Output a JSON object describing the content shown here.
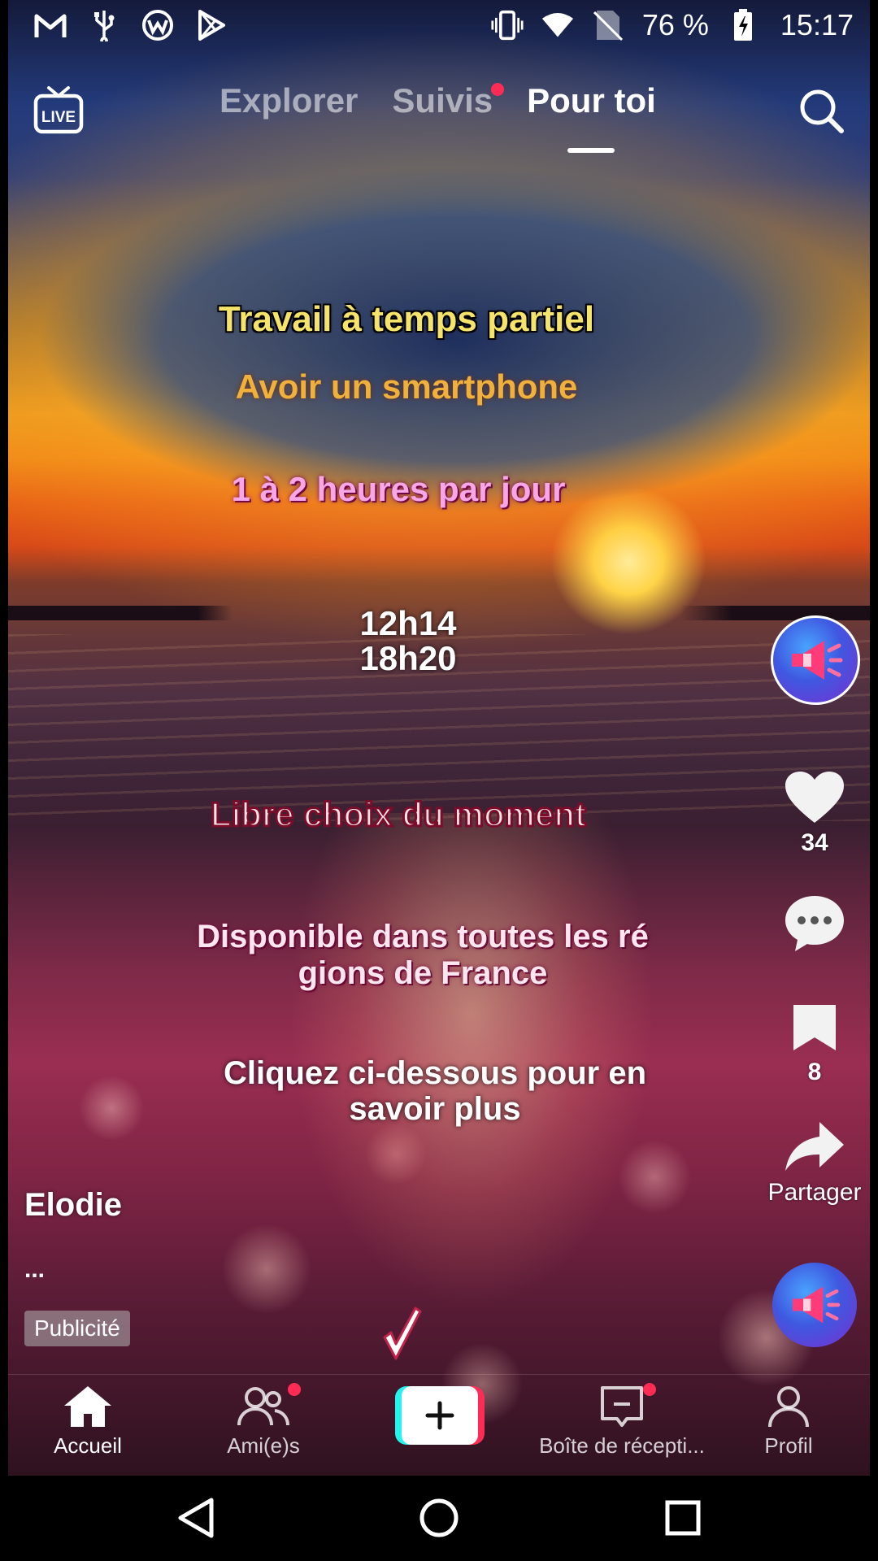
{
  "status_bar": {
    "left_icons": [
      "gmail-icon",
      "usb-icon",
      "app-notification-icon",
      "play-store-icon"
    ],
    "right_icons": [
      "vibrate-icon",
      "wifi-icon",
      "no-sim-icon",
      "battery-charging-icon"
    ],
    "battery": "76 %",
    "time": "15:17"
  },
  "top_nav": {
    "live_icon": "live-icon",
    "tabs": [
      {
        "label": "Explorer"
      },
      {
        "label": "Suivis",
        "has_dot": true
      },
      {
        "label": "Pour toi",
        "active": true
      }
    ],
    "search_icon": "search-icon"
  },
  "overlay": {
    "line1": "Travail à temps partiel",
    "line2": "Avoir un smartphone",
    "line3": "1 à 2 heures par jour",
    "line4a": "12h14",
    "line4b": "18h20",
    "line5": "Libre choix du moment",
    "line6a": "Disponible dans toutes les ré",
    "line6b": "gions de France",
    "line7a": "Cliquez ci-dessous pour en",
    "line7b": "savoir plus"
  },
  "actions": {
    "likes": "34",
    "bookmarks": "8",
    "share_label": "Partager"
  },
  "post": {
    "author": "Elodie",
    "caption": "...",
    "ad_label": "Publicité"
  },
  "bottom_nav": {
    "home": "Accueil",
    "friends": "Ami(e)s",
    "inbox": "Boîte de récepti...",
    "profile": "Profil"
  },
  "colors": {
    "accent_red": "#fe2c55",
    "accent_cyan": "#25f4ee"
  }
}
